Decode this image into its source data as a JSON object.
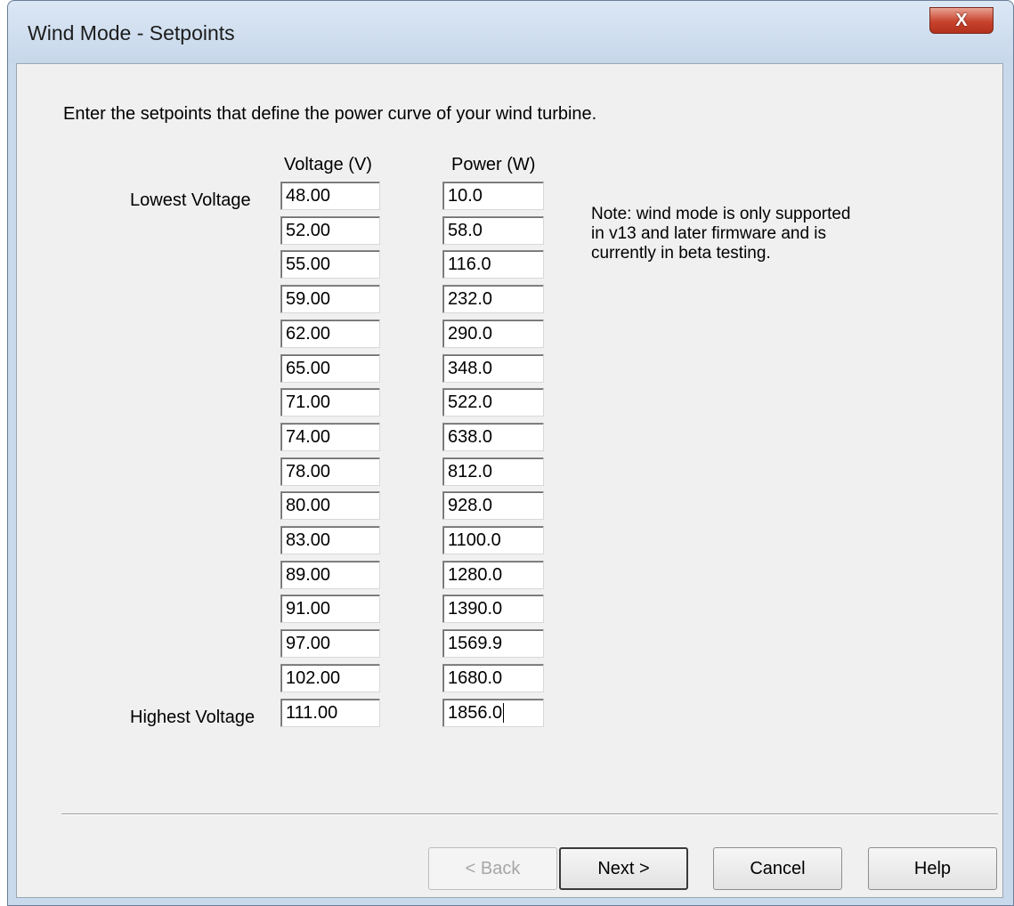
{
  "window": {
    "title": "Wind Mode - Setpoints",
    "close_label": "X"
  },
  "instruction": "Enter the setpoints that define the power curve of your wind turbine.",
  "columns": {
    "voltage": "Voltage (V)",
    "power": "Power (W)"
  },
  "row_labels": {
    "lowest": "Lowest Voltage",
    "highest": "Highest Voltage"
  },
  "setpoints": [
    {
      "voltage": "48.00",
      "power": "10.0"
    },
    {
      "voltage": "52.00",
      "power": "58.0"
    },
    {
      "voltage": "55.00",
      "power": "116.0"
    },
    {
      "voltage": "59.00",
      "power": "232.0"
    },
    {
      "voltage": "62.00",
      "power": "290.0"
    },
    {
      "voltage": "65.00",
      "power": "348.0"
    },
    {
      "voltage": "71.00",
      "power": "522.0"
    },
    {
      "voltage": "74.00",
      "power": "638.0"
    },
    {
      "voltage": "78.00",
      "power": "812.0"
    },
    {
      "voltage": "80.00",
      "power": "928.0"
    },
    {
      "voltage": "83.00",
      "power": "1100.0"
    },
    {
      "voltage": "89.00",
      "power": "1280.0"
    },
    {
      "voltage": "91.00",
      "power": "1390.0"
    },
    {
      "voltage": "97.00",
      "power": "1569.9"
    },
    {
      "voltage": "102.00",
      "power": "1680.0"
    },
    {
      "voltage": "111.00",
      "power": "1856.0"
    }
  ],
  "note": "Note: wind mode is only supported in v13 and later firmware and is currently in beta testing.",
  "buttons": {
    "back": "< Back",
    "next": "Next >",
    "cancel": "Cancel",
    "help": "Help"
  },
  "colors": {
    "title_bar": "#c9d9ec",
    "close_button": "#c7432c",
    "dialog_background": "#f0f0f0"
  }
}
